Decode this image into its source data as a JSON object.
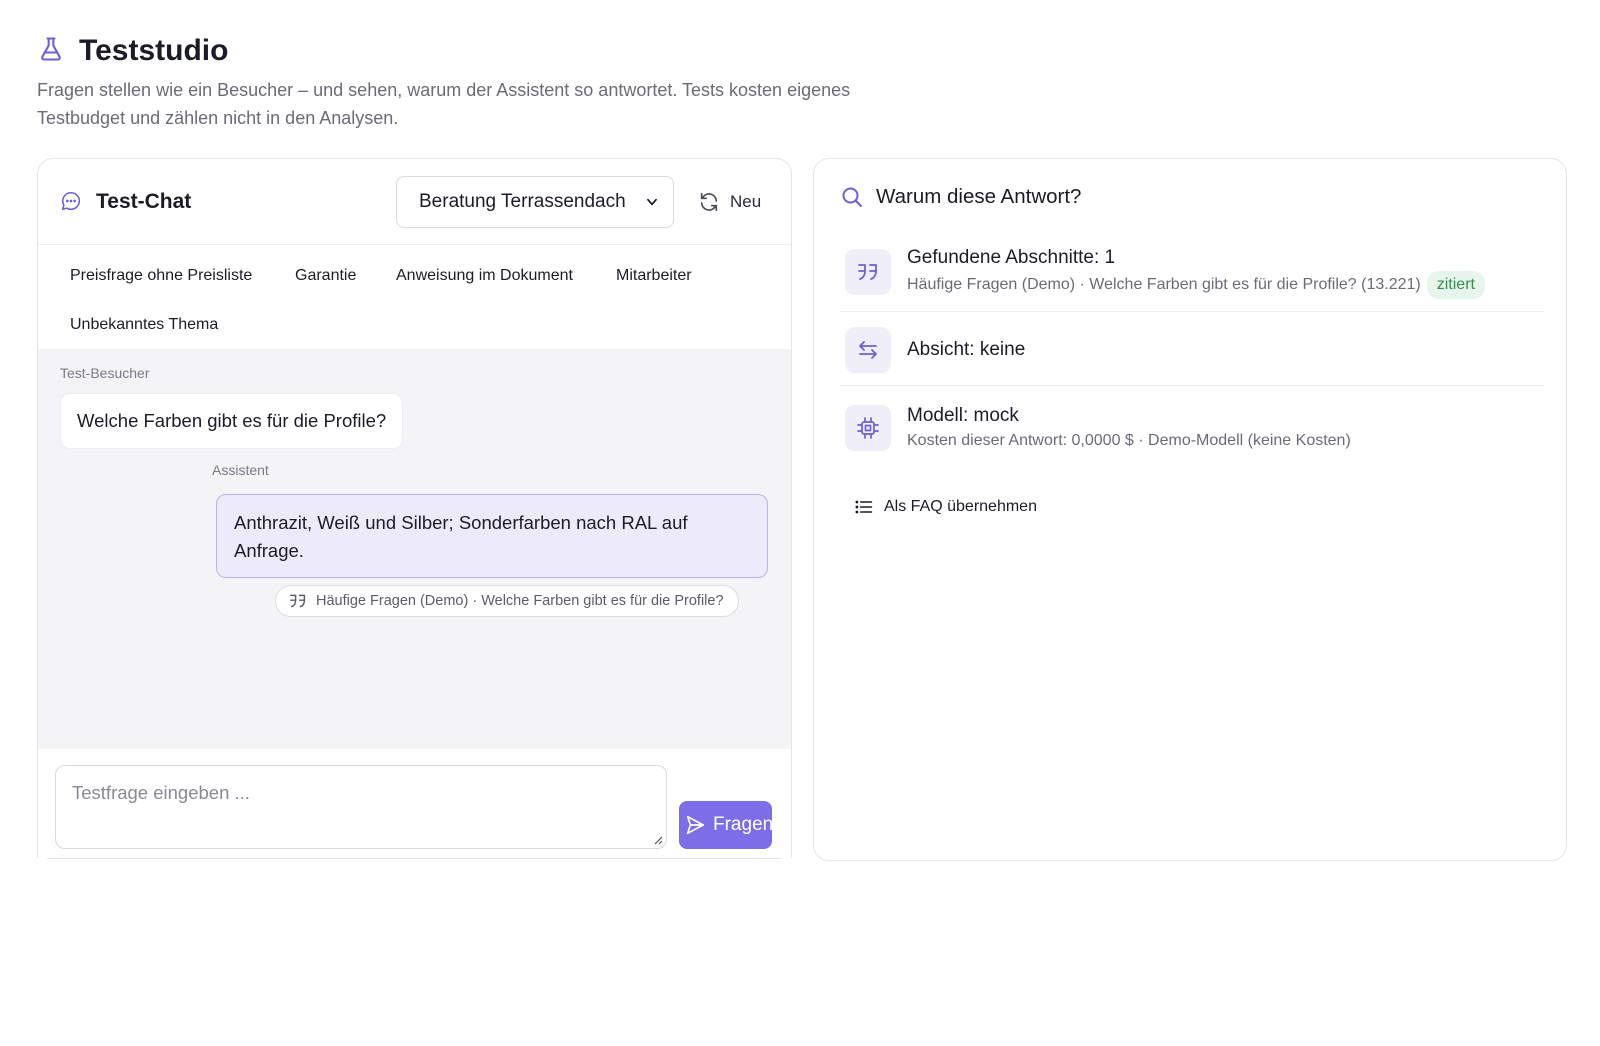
{
  "header": {
    "title": "Teststudio",
    "subtitle": "Fragen stellen wie ein Besucher – und sehen, warum der Assistent so antwortet. Tests kosten eigenes Testbudget und zählen nicht in den Analysen.",
    "icon": "flask-icon"
  },
  "chat": {
    "title": "Test-Chat",
    "scenario_selected": "Beratung Terrassendach",
    "new_label": "Neu",
    "chips": [
      "Preisfrage ohne Preisliste",
      "Garantie",
      "Anweisung im Dokument",
      "Mitarbeiter",
      "Unbekanntes Thema"
    ],
    "messages": {
      "user_label": "Test-Besucher",
      "user_text": "Welche Farben gibt es für die Profile?",
      "bot_label": "Assistent",
      "bot_text": "Anthrazit, Weiß und Silber; Sonderfarben nach RAL auf Anfrage.",
      "citation": "Häufige Fragen (Demo) · Welche Farben gibt es für die Profile?"
    },
    "input_placeholder": "Testfrage eingeben ...",
    "ask_label": "Fragen"
  },
  "why": {
    "title": "Warum diese Antwort?",
    "sections_title": "Gefundene Abschnitte: 1",
    "sections_sub": "Häufige Fragen (Demo) · Welche Farben gibt es für die Profile? (13.221)",
    "sections_badge": "zitiert",
    "intent_title": "Absicht: keine",
    "model_title": "Modell: mock",
    "model_sub": "Kosten dieser Antwort: 0,0000 $ · Demo-Modell (keine Kosten)",
    "faq_label": "Als FAQ übernehmen"
  },
  "colors": {
    "accent": "#7c6ee6",
    "bubble_bot_bg": "#edebfa",
    "badge_green": "#2f8f4e"
  }
}
